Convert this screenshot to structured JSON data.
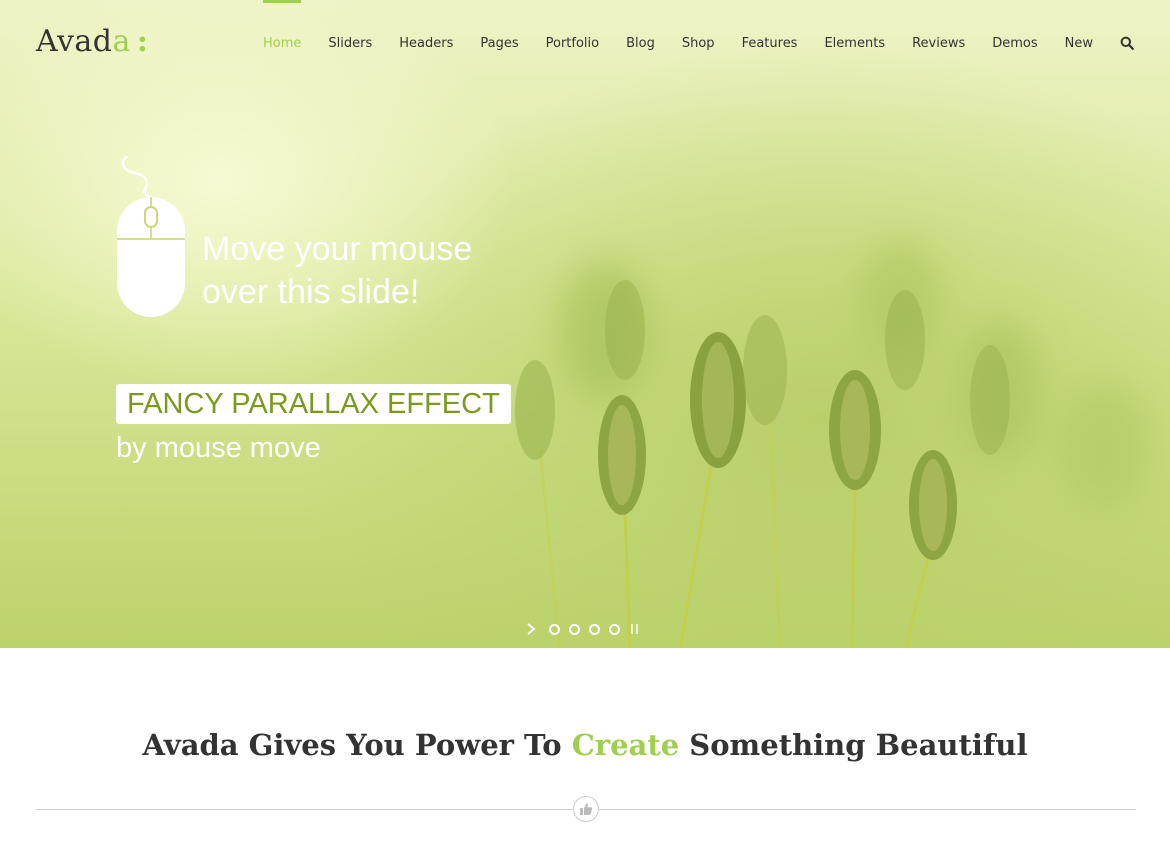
{
  "brand": {
    "logo_main": "Avad",
    "logo_accent": "a",
    "logo_colon": ":"
  },
  "nav": {
    "items": [
      {
        "label": "Home",
        "active": true
      },
      {
        "label": "Sliders"
      },
      {
        "label": "Headers"
      },
      {
        "label": "Pages"
      },
      {
        "label": "Portfolio"
      },
      {
        "label": "Blog"
      },
      {
        "label": "Shop"
      },
      {
        "label": "Features"
      },
      {
        "label": "Elements"
      },
      {
        "label": "Reviews"
      },
      {
        "label": "Demos"
      },
      {
        "label": "New"
      }
    ],
    "search_icon": "search-icon"
  },
  "slide": {
    "headline_line1": "Move your mouse",
    "headline_line2": "over this slide!",
    "badge": "FANCY PARALLAX EFFECT",
    "subline": "by mouse move",
    "icon": "mouse-icon"
  },
  "slider": {
    "slides": 4,
    "active_index": 0
  },
  "section": {
    "headline_before": "Avada Gives You Power To ",
    "headline_accent": "Create",
    "headline_after": " Something Beautiful",
    "separator_icon": "thumbs-up-icon"
  },
  "colors": {
    "accent": "#a0ce4e",
    "badge_text": "#7a9a1e",
    "text": "#333333"
  }
}
